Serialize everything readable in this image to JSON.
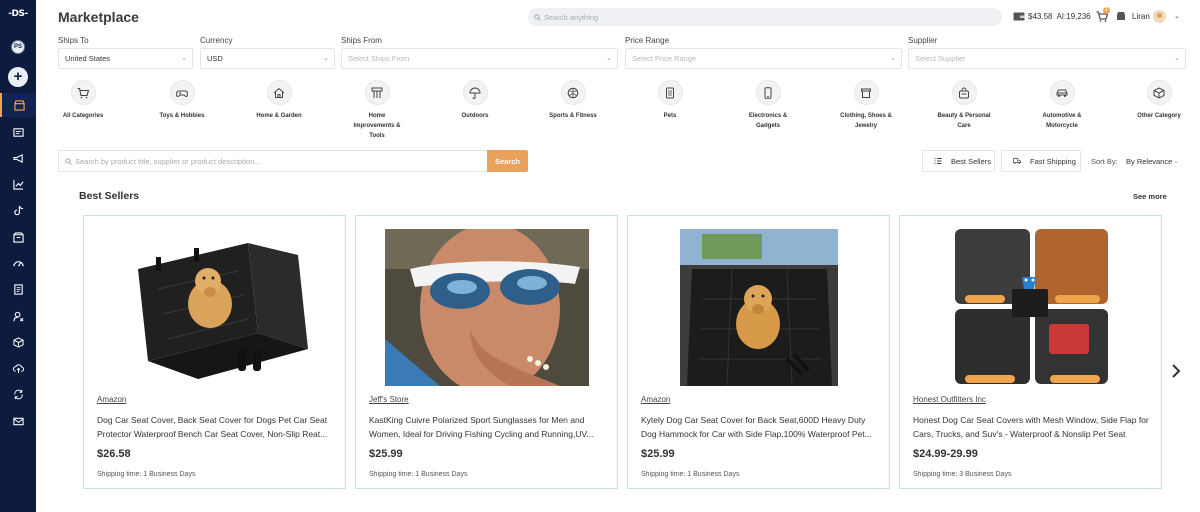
{
  "header": {
    "title": "Marketplace",
    "search_placeholder": "Search anything",
    "balance": "$43.58",
    "ai_credits": "AI:19,236",
    "cart_count": "1",
    "user_name": "Liran"
  },
  "sidebar": {
    "logo": "-DS-",
    "avatar_initials": "PS"
  },
  "filters": {
    "ships_to": {
      "label": "Ships To",
      "value": "United States"
    },
    "currency": {
      "label": "Currency",
      "value": "USD"
    },
    "ships_from": {
      "label": "Ships From",
      "placeholder": "Select Ships From"
    },
    "price_range": {
      "label": "Price Range",
      "placeholder": "Select Price Range"
    },
    "supplier": {
      "label": "Supplier",
      "placeholder": "Select Supplier"
    }
  },
  "categories": [
    {
      "label": "All Categories",
      "icon": "cart-icon"
    },
    {
      "label": "Toys & Hobbies",
      "icon": "gamepad-icon"
    },
    {
      "label": "Home & Garden",
      "icon": "house-icon"
    },
    {
      "label": "Home Improvements & Tools",
      "icon": "tools-icon"
    },
    {
      "label": "Outdoors",
      "icon": "umbrella-icon"
    },
    {
      "label": "Sports & Fitness",
      "icon": "ball-icon"
    },
    {
      "label": "Pets",
      "icon": "pet-food-icon"
    },
    {
      "label": "Electronics & Gadgets",
      "icon": "phone-icon"
    },
    {
      "label": "Clothing, Shoes & Jewelry",
      "icon": "shirt-icon"
    },
    {
      "label": "Beauty & Personal Care",
      "icon": "bag-icon"
    },
    {
      "label": "Automotive & Motorcycle",
      "icon": "car-icon"
    },
    {
      "label": "Other Category",
      "icon": "box-icon"
    }
  ],
  "product_search": {
    "placeholder": "Search by product title, supplier or product description...",
    "button": "Search"
  },
  "toolbar": {
    "best_sellers": "Best Sellers",
    "fast_shipping": "Fast Shipping",
    "sort_label": "Sort By:",
    "sort_value": "By Relevance"
  },
  "section": {
    "title": "Best Sellers",
    "see_more": "See more"
  },
  "products": [
    {
      "supplier": "Amazon",
      "title": "Dog Car Seat Cover, Back Seat Cover for Dogs Pet Car Seat Protector Waterproof Bench Car Seat Cover, Non-Slip Reat...",
      "price": "$26.58",
      "shipping": "Shipping time: 1 Business Days"
    },
    {
      "supplier": "Jeff's Store",
      "title": "KastKing Cuivre Polarized Sport Sunglasses for Men and Women, Ideal for Driving Fishing Cycling and Running,UV...",
      "price": "$25.99",
      "shipping": "Shipping time: 1 Business Days"
    },
    {
      "supplier": "Amazon",
      "title": "Kytely Dog Car Seat Cover for Back Seat,600D Heavy Duty Dog Hammock for Car with Side Flap,100% Waterproof Pet...",
      "price": "$25.99",
      "shipping": "Shipping time: 1 Business Days"
    },
    {
      "supplier": "Honest Outfitters Inc",
      "title": "Honest Dog Car Seat Covers with Mesh Window, Side Flap for Cars, Trucks, and Suv's - Waterproof & Nonslip Pet Seat Cove...",
      "price": "$24.99-29.99",
      "shipping": "Shipping time: 3 Business Days"
    }
  ]
}
